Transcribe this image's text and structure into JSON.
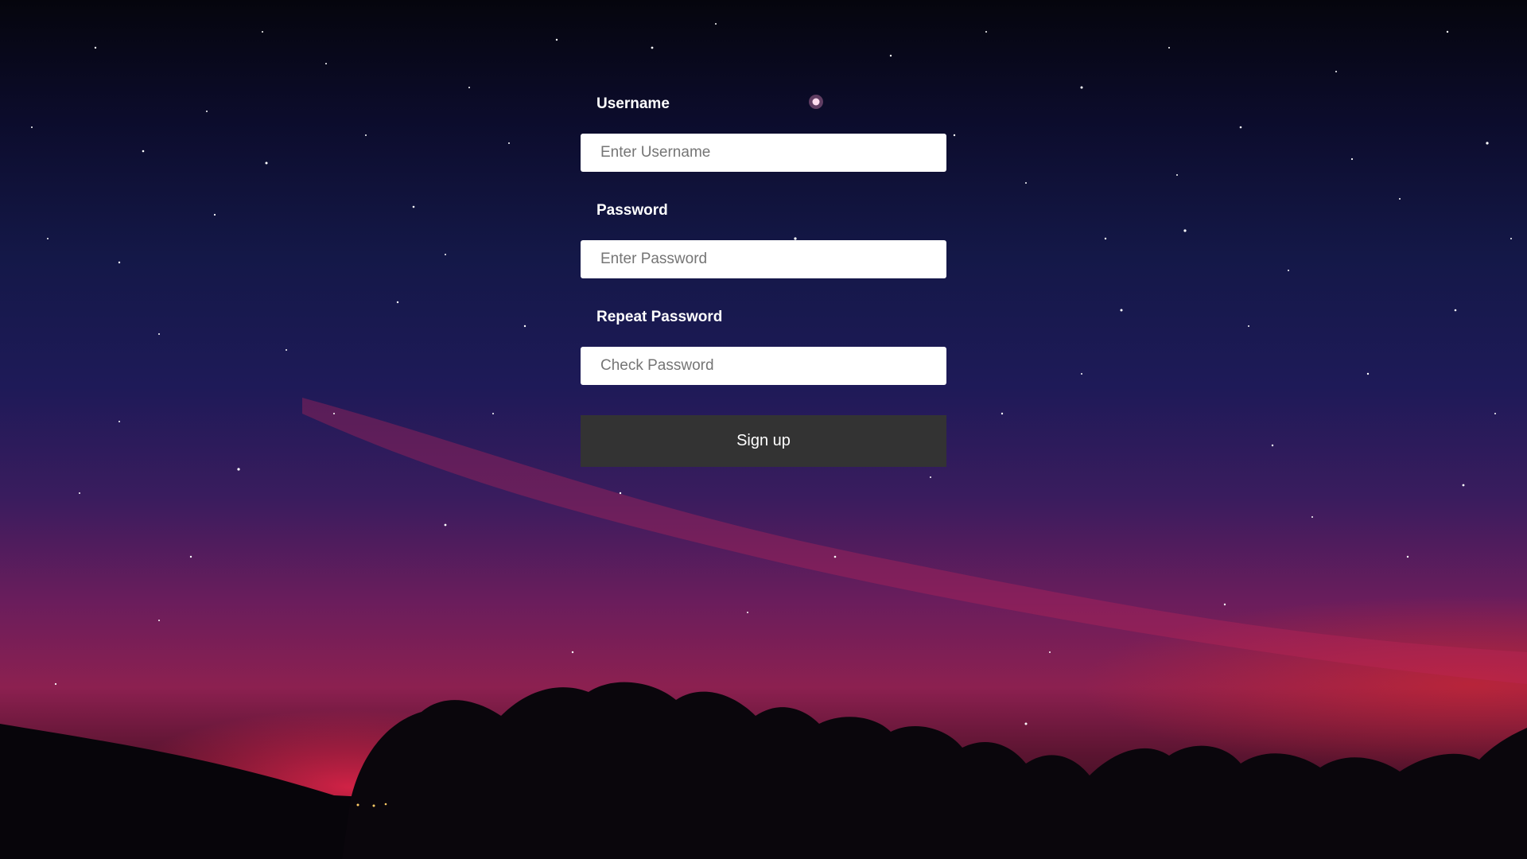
{
  "form": {
    "username_label": "Username",
    "username_placeholder": "Enter Username",
    "password_label": "Password",
    "password_placeholder": "Enter Password",
    "repeat_label": "Repeat Password",
    "repeat_placeholder": "Check Password",
    "submit_label": "Sign up"
  },
  "colors": {
    "button_bg": "#333333",
    "label_text": "#ffffff",
    "sky_top": "#05050d",
    "sky_mid": "#1e1a58",
    "aurora": "#8c2050"
  }
}
